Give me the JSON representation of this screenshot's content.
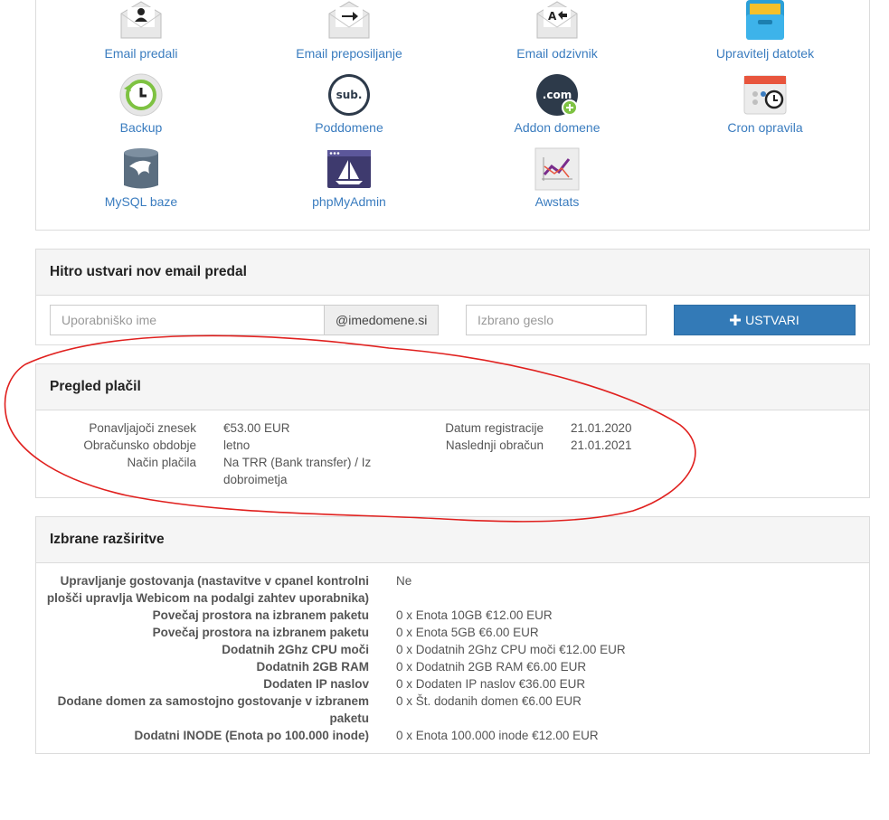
{
  "shortcuts": [
    {
      "label": "Email predali",
      "icon": "email-account-icon"
    },
    {
      "label": "Email preposiljanje",
      "icon": "email-forward-icon"
    },
    {
      "label": "Email odzivnik",
      "icon": "email-autoresponder-icon"
    },
    {
      "label": "Upravitelj datotek",
      "icon": "file-manager-icon"
    },
    {
      "label": "Backup",
      "icon": "backup-icon"
    },
    {
      "label": "Poddomene",
      "icon": "subdomain-icon"
    },
    {
      "label": "Addon domene",
      "icon": "addon-domain-icon"
    },
    {
      "label": "Cron opravila",
      "icon": "cron-jobs-icon"
    },
    {
      "label": "MySQL baze",
      "icon": "mysql-icon"
    },
    {
      "label": "phpMyAdmin",
      "icon": "phpmyadmin-icon"
    },
    {
      "label": "Awstats",
      "icon": "awstats-icon"
    }
  ],
  "icon_text": {
    "sub": "sub.",
    "com": ".com"
  },
  "quick_email": {
    "title": "Hitro ustvari nov email predal",
    "username_placeholder": "Uporabniško ime",
    "domain_suffix": "@imedomene.si",
    "password_placeholder": "Izbrano geslo",
    "create_label": "USTVARI"
  },
  "billing": {
    "title": "Pregled plačil",
    "left": [
      {
        "label": "Ponavljajoči znesek",
        "value": "€53.00 EUR"
      },
      {
        "label": "Obračunsko obdobje",
        "value": "letno"
      },
      {
        "label": "Način plačila",
        "value": "Na TRR (Bank transfer) / Iz dobroimetja"
      }
    ],
    "right": [
      {
        "label": "Datum registracije",
        "value": "21.01.2020"
      },
      {
        "label": "Naslednji obračun",
        "value": "21.01.2021"
      }
    ]
  },
  "extensions": {
    "title": "Izbrane razširitve",
    "rows": [
      {
        "label": "Upravljanje gostovanja (nastavitve v cpanel kontrolni plošči upravlja Webicom na podalgi zahtev uporabnika)",
        "value": "Ne"
      },
      {
        "label": "Povečaj prostora na izbranem paketu",
        "value": "0 x Enota 10GB €12.00 EUR"
      },
      {
        "label": "Povečaj prostora na izbranem paketu",
        "value": "0 x Enota 5GB €6.00 EUR"
      },
      {
        "label": "Dodatnih 2Ghz CPU moči",
        "value": "0 x Dodatnih 2Ghz CPU moči €12.00 EUR"
      },
      {
        "label": "Dodatnih 2GB RAM",
        "value": "0 x Dodatnih 2GB RAM €6.00 EUR"
      },
      {
        "label": "Dodaten IP naslov",
        "value": "0 x Dodaten IP naslov €36.00 EUR"
      },
      {
        "label": "Dodane domen za samostojno gostovanje v izbranem paketu",
        "value": "0 x Št. dodanih domen €6.00 EUR"
      },
      {
        "label": "Dodatni INODE (Enota po 100.000 inode)",
        "value": "0 x Enota 100.000 inode €12.00 EUR"
      }
    ]
  },
  "colors": {
    "link": "#3a7cbf",
    "button": "#337ab7",
    "annotation": "#e0201e"
  }
}
